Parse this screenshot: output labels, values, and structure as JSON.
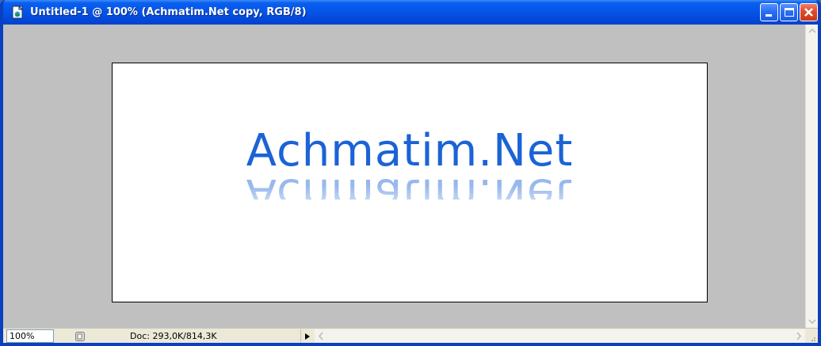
{
  "window": {
    "title": "Untitled-1 @ 100% (Achmatim.Net copy, RGB/8)",
    "icon": "photoshop-document-icon",
    "controls": {
      "minimize_icon": "minimize-icon",
      "maximize_icon": "maximize-icon",
      "close_icon": "close-icon"
    }
  },
  "document": {
    "text": "Achmatim.Net",
    "text_color": "#1b63d6",
    "background": "#ffffff"
  },
  "workspace": {
    "background": "#c0c0c0"
  },
  "statusbar": {
    "zoom": "100%",
    "status_icon": "document-status-icon",
    "doc_info": "Doc: 293,0K/814,3K",
    "menu_arrow_icon": "triangle-right-icon"
  },
  "colors": {
    "titlebar": "#0454e6",
    "close_button": "#e04a2a",
    "statusbar_bg": "#ece9d8"
  }
}
